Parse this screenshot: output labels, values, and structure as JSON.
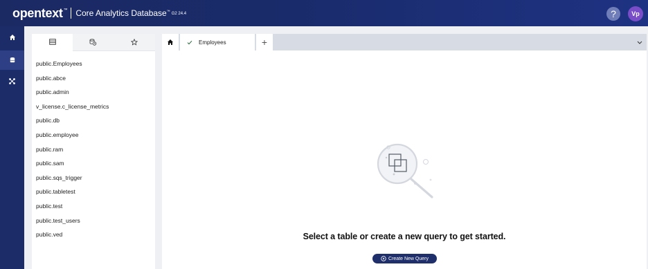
{
  "header": {
    "logo_text": "opentext",
    "logo_tm": "™",
    "product_name": "Core Analytics Database",
    "product_tm": "™",
    "version": "G2 24.4",
    "help_label": "?",
    "avatar_initials": "Vp"
  },
  "rail": {
    "items": [
      "home-icon",
      "database-icon",
      "connections-icon"
    ],
    "active_index": 1
  },
  "left_panel": {
    "tabs": [
      "tables-icon",
      "history-icon",
      "star-icon"
    ],
    "active_tab": 0,
    "tables": [
      "public.Employees",
      "public.abce",
      "public.admin",
      "v_license.c_license_metrics",
      "public.db",
      "public.employee",
      "public.ram",
      "public.sam",
      "public.sqs_trigger",
      "public.tabletest",
      "public.test",
      "public.test_users",
      "public.ved"
    ]
  },
  "main": {
    "tabs": [
      {
        "icon": "home-icon"
      },
      {
        "label": "Employees",
        "status_icon": "check-icon"
      }
    ],
    "add_tab_label": "+",
    "empty_message": "Select a table or create a new query to get started.",
    "create_button_label": "Create New Query"
  },
  "colors": {
    "header_bg": "#1b2a63",
    "rail_bg": "#1c2c68",
    "button_bg": "#1e2f6b",
    "avatar_bg": "#7a4dc8"
  }
}
